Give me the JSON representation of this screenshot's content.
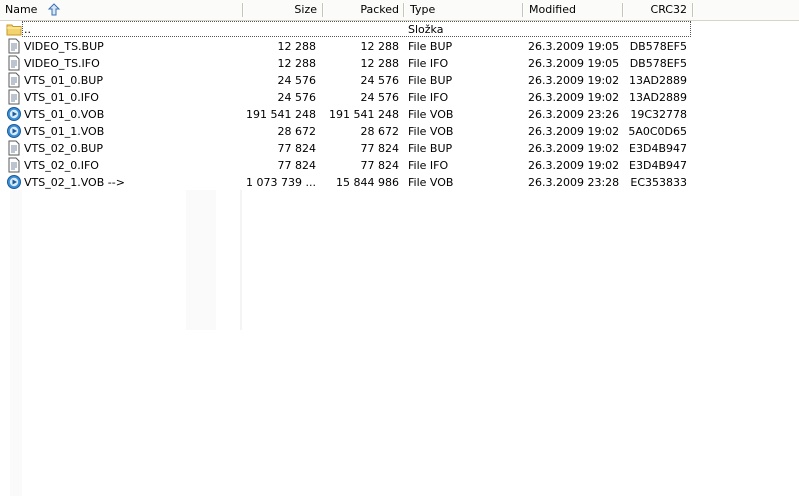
{
  "columns": {
    "name": "Name",
    "size": "Size",
    "packed": "Packed",
    "type": "Type",
    "modified": "Modified",
    "crc": "CRC32"
  },
  "rows": [
    {
      "icon": "folder-up-icon",
      "name": "..",
      "size": "",
      "packed": "",
      "type": "Složka",
      "modified": "",
      "crc": ""
    },
    {
      "icon": "document-icon",
      "name": "VIDEO_TS.BUP",
      "size": "12 288",
      "packed": "12 288",
      "type": "File BUP",
      "modified": "26.3.2009 19:05",
      "crc": "DB578EF5"
    },
    {
      "icon": "document-icon",
      "name": "VIDEO_TS.IFO",
      "size": "12 288",
      "packed": "12 288",
      "type": "File IFO",
      "modified": "26.3.2009 19:05",
      "crc": "DB578EF5"
    },
    {
      "icon": "document-icon",
      "name": "VTS_01_0.BUP",
      "size": "24 576",
      "packed": "24 576",
      "type": "File BUP",
      "modified": "26.3.2009 19:02",
      "crc": "13AD2889"
    },
    {
      "icon": "document-icon",
      "name": "VTS_01_0.IFO",
      "size": "24 576",
      "packed": "24 576",
      "type": "File IFO",
      "modified": "26.3.2009 19:02",
      "crc": "13AD2889"
    },
    {
      "icon": "media-icon",
      "name": "VTS_01_0.VOB",
      "size": "191 541 248",
      "packed": "191 541 248",
      "type": "File VOB",
      "modified": "26.3.2009 23:26",
      "crc": "19C32778"
    },
    {
      "icon": "media-icon",
      "name": "VTS_01_1.VOB",
      "size": "28 672",
      "packed": "28 672",
      "type": "File VOB",
      "modified": "26.3.2009 19:02",
      "crc": "5A0C0D65"
    },
    {
      "icon": "document-icon",
      "name": "VTS_02_0.BUP",
      "size": "77 824",
      "packed": "77 824",
      "type": "File BUP",
      "modified": "26.3.2009 19:02",
      "crc": "E3D4B947"
    },
    {
      "icon": "document-icon",
      "name": "VTS_02_0.IFO",
      "size": "77 824",
      "packed": "77 824",
      "type": "File IFO",
      "modified": "26.3.2009 19:02",
      "crc": "E3D4B947"
    },
    {
      "icon": "media-icon",
      "name": "VTS_02_1.VOB -->",
      "size": "1 073 739 ...",
      "packed": "15 844 986",
      "type": "File VOB",
      "modified": "26.3.2009 23:28",
      "crc": "EC353833"
    }
  ],
  "colors": {
    "header_bg": "#fbfbf9",
    "header_border": "#d8d5c8",
    "folder": "#f3d36b",
    "media": "#3b8fd6"
  }
}
